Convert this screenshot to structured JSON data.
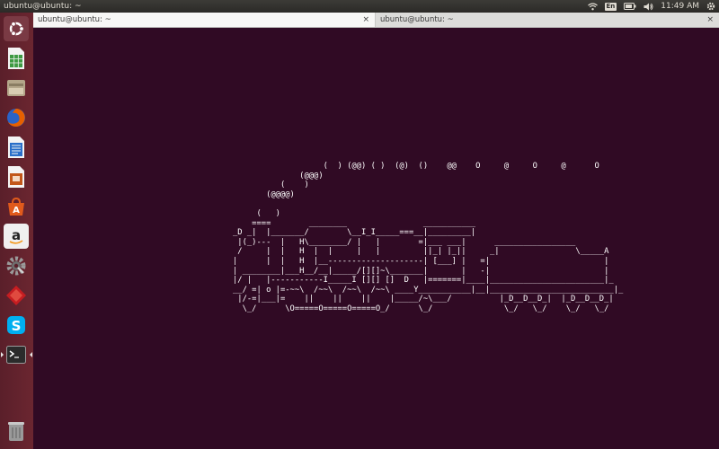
{
  "panel": {
    "title": "ubuntu@ubuntu: ~",
    "keyboard_layout": "En",
    "clock": "11:49 AM"
  },
  "launcher": {
    "items": [
      {
        "name": "ubuntu-dash-icon",
        "color": "#dd4814"
      },
      {
        "name": "spreadsheet-icon",
        "color": "#3d9a42"
      },
      {
        "name": "file-manager-icon",
        "color": "#b4a68a"
      },
      {
        "name": "firefox-icon",
        "color": "#e66000"
      },
      {
        "name": "writer-document-icon",
        "color": "#2a6fc9"
      },
      {
        "name": "presentation-icon",
        "color": "#c2571a"
      },
      {
        "name": "software-center-icon",
        "color": "#e05a1c"
      },
      {
        "name": "amazon-icon",
        "color": "#f0f0f0"
      },
      {
        "name": "settings-icon",
        "color": "#8a8a8a"
      },
      {
        "name": "red-diamond-app-icon",
        "color": "#c51d21"
      },
      {
        "name": "skype-icon",
        "color": "#00aff0"
      },
      {
        "name": "terminal-icon",
        "color": "#2b2b2b"
      },
      {
        "name": "trash-icon",
        "color": "#9a9a9a"
      }
    ]
  },
  "tabs": [
    {
      "label": "ubuntu@ubuntu: ~",
      "close": "×",
      "active": true
    },
    {
      "label": "ubuntu@ubuntu: ~",
      "close": "×",
      "active": false
    }
  ],
  "terminal": {
    "ascii_art": "                   (  ) (@@) ( )  (@)  ()    @@    O     @     O     @      O\n              (@@@)\n          (    )\n       (@@@@)\n\n     (   )\n    ====        ________                ___________\n_D _|  |_______/        \\__I_I_____===__|_________|\n |(_)---  |   H\\________/ |   |        =|___ ___|      _________________\n /     |  |   H  |  |     |   |         ||_| |_||     _|                \\_____A\n|      |  |   H  |__--------------------| [___] |   =|                        |\n| ________|___H__/__|_____/[][]~\\_______|       |   -|                        |\n|/ |   |-----------I_____I [][] []  D   |=======|____|________________________|_\n__/ =| o |=-~~\\  /~~\\  /~~\\  /~~\\ ____Y___________|__|__________________________|_\n |/-=|___|=    ||    ||    ||    |_____/~\\___/          |_D__D__D_|  |_D__D__D_|\n  \\_/      \\O=====O=====O=====O_/      \\_/               \\_/   \\_/    \\_/   \\_/"
  }
}
